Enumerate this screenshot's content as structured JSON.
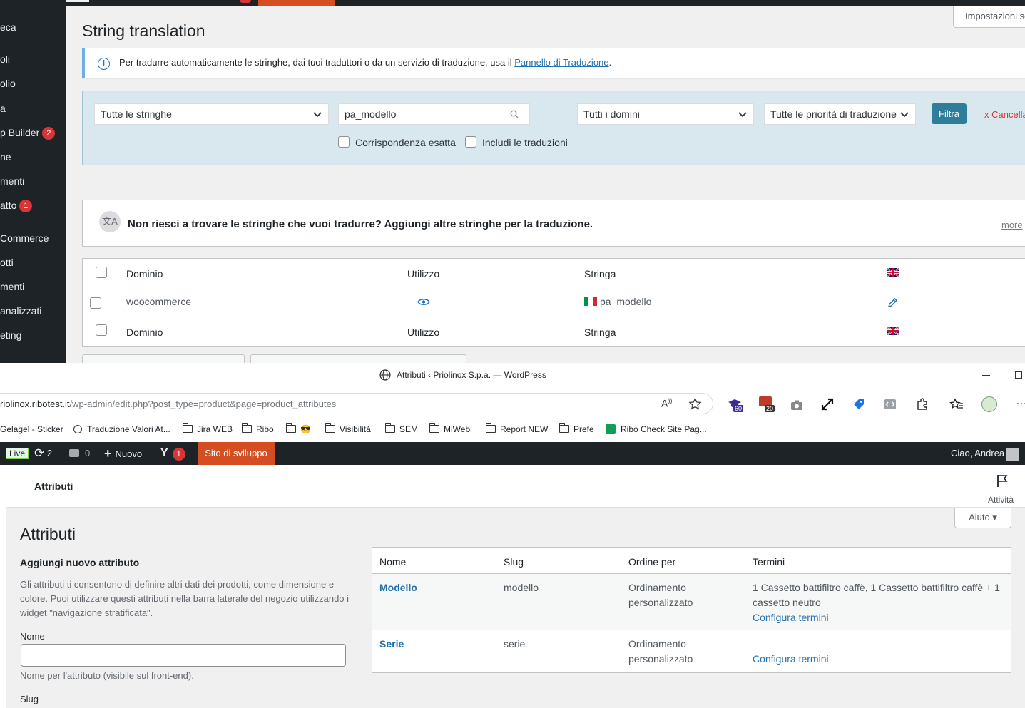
{
  "top_window": {
    "sidebar_items": [
      {
        "label": "eca",
        "badge": ""
      },
      {
        "label": "oli",
        "badge": ""
      },
      {
        "label": "olio",
        "badge": ""
      },
      {
        "label": "a",
        "badge": ""
      },
      {
        "label": "p Builder",
        "badge": "2"
      },
      {
        "label": "ne",
        "badge": ""
      },
      {
        "label": "menti",
        "badge": ""
      },
      {
        "label": "atto",
        "badge": "1"
      },
      {
        "label": "Commerce",
        "badge": ""
      },
      {
        "label": "otti",
        "badge": ""
      },
      {
        "label": "menti",
        "badge": ""
      },
      {
        "label": "analizzati",
        "badge": ""
      },
      {
        "label": "eting",
        "badge": ""
      }
    ],
    "screen_options_label": "Impostazioni sc",
    "page_title": "String translation",
    "notice": {
      "text_before": "Per tradurre automaticamente le stringhe, dai tuoi traduttori o da un servizio di traduzione, usa il ",
      "link": "Pannello di Traduzione",
      "text_after": "."
    },
    "filters": {
      "strings_select": "Tutte le stringhe",
      "search_value": "pa_modello",
      "domains_select": "Tutti i domini",
      "priority_select": "Tutte le priorità di traduzione",
      "filter_button": "Filtra",
      "cancel_link": "x  Cancella",
      "exact_match": "Corrispondenza esatta",
      "include_translations": "Includi le traduzioni"
    },
    "add_strings": {
      "text": "Non riesci a trovare le stringhe che vuoi tradurre? Aggiungi altre stringhe per la traduzione.",
      "more": "more"
    },
    "table": {
      "headers": {
        "domain": "Dominio",
        "usage": "Utilizzo",
        "string": "Stringa"
      },
      "rows": [
        {
          "domain": "woocommerce",
          "string": "pa_modello"
        }
      ]
    }
  },
  "browser": {
    "window_title": "Attributi ‹ Priolinox S.p.a. — WordPress",
    "url_host": "riolinox.ribotest.it",
    "url_path": "/wp-admin/edit.php?post_type=product&page=product_attributes",
    "extension_badges": {
      "a": "60",
      "b": "20"
    },
    "bookmarks": [
      {
        "label": "Gelagel - Sticker",
        "type": "text"
      },
      {
        "label": "Traduzione Valori At...",
        "type": "site"
      },
      {
        "label": "Jira WEB",
        "type": "folder"
      },
      {
        "label": "Ribo",
        "type": "folder"
      },
      {
        "label": "😎",
        "type": "folder"
      },
      {
        "label": "Visibilità",
        "type": "folder"
      },
      {
        "label": "SEM",
        "type": "folder"
      },
      {
        "label": "MiWebl",
        "type": "folder"
      },
      {
        "label": "Report NEW",
        "type": "folder"
      },
      {
        "label": "Prefe",
        "type": "folder"
      },
      {
        "label": "Ribo Check Site Pag...",
        "type": "sheet"
      }
    ]
  },
  "wp_adminbar": {
    "live": "Live",
    "updates": "2",
    "comments": "0",
    "new": "Nuovo",
    "yoast_badge": "1",
    "dev_site": "Sito di sviluppo",
    "greeting": "Ciao, Andrea"
  },
  "wc": {
    "breadcrumb": "Attributi",
    "activity": "Attività",
    "help": "Aiuto ▾",
    "page_title": "Attributi",
    "add_new": {
      "heading": "Aggiungi nuovo attributo",
      "description": "Gli attributi ti consentono di definire altri dati dei prodotti, come dimensione e colore. Puoi utilizzare questi attributi nella barra laterale del negozio utilizzando i widget \"navigazione stratificata\".",
      "name_label": "Nome",
      "name_value": "",
      "name_help": "Nome per l'attributo (visibile sul front-end).",
      "slug_label": "Slug"
    },
    "table": {
      "headers": {
        "name": "Nome",
        "slug": "Slug",
        "order": "Ordine per",
        "terms": "Termini"
      },
      "rows": [
        {
          "name": "Modello",
          "slug": "modello",
          "order": "Ordinamento personalizzato",
          "terms": "1 Cassetto battifiltro caffè, 1 Cassetto battifiltro caffè + 1 cassetto neutro",
          "configure": "Configura termini"
        },
        {
          "name": "Serie",
          "slug": "serie",
          "order": "Ordinamento personalizzato",
          "terms": "–",
          "configure": "Configura termini"
        }
      ]
    }
  }
}
